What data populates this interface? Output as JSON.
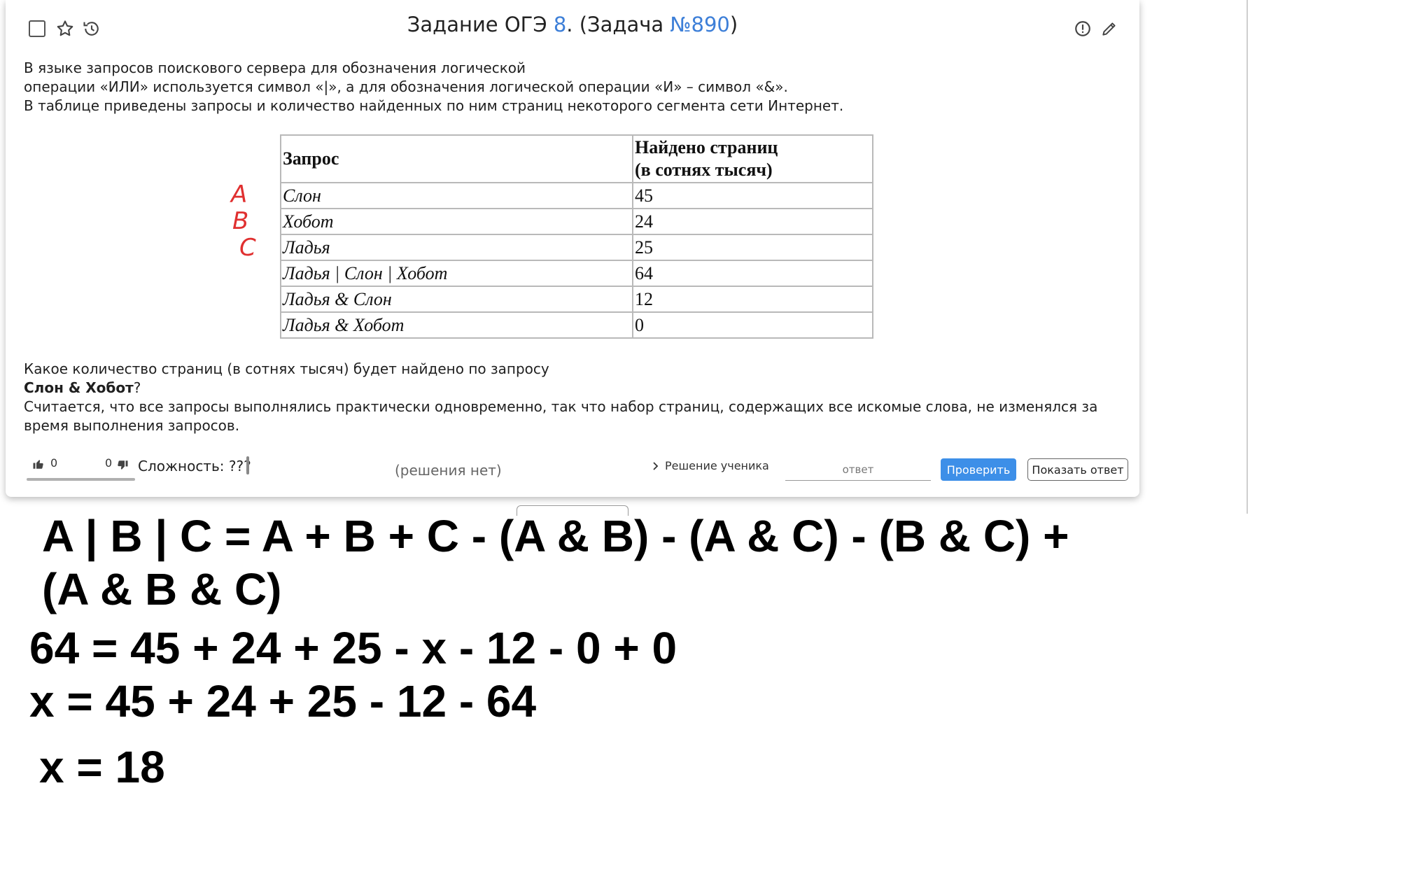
{
  "header": {
    "title_prefix": "Задание ОГЭ ",
    "task_number": "8",
    "title_middle": ". (Задача ",
    "problem_id": "№890",
    "title_suffix": ")"
  },
  "problem": {
    "lines": [
      "В языке запросов поискового сервера для обозначения логической",
      "операции «ИЛИ» используется символ «|», а для обозначения логической операции «И» – символ «&».",
      "В таблице приведены запросы и количество найденных по ним страниц некоторого сегмента сети Интернет."
    ],
    "table": {
      "headers": [
        "Запрос",
        "Найдено страниц\n(в сотнях тысяч)"
      ],
      "rows": [
        [
          "Слон",
          "45"
        ],
        [
          "Хобот",
          "24"
        ],
        [
          "Ладья",
          "25"
        ],
        [
          "Ладья | Слон | Хобот",
          "64"
        ],
        [
          "Ладья & Слон",
          "12"
        ],
        [
          "Ладья & Хобот",
          "0"
        ]
      ]
    },
    "annotations": [
      "A",
      "B",
      "C"
    ],
    "question": "Какое количество страниц (в сотнях тысяч) будет найдено по запросу",
    "query_bold": "Слон & Хобот",
    "query_suffix": "?",
    "note": "Считается, что все запросы выполнялись практически одновременно, так что набор страниц, содержащих все искомые слова, не изменялся за время выполнения запросов."
  },
  "footer": {
    "likes": "0",
    "dislikes": "0",
    "difficulty_label": "Сложность: ???",
    "solutions": "(решения нет)",
    "student_solution": "Решение ученика",
    "answer_placeholder": "ответ",
    "check_label": "Проверить",
    "show_label": "Показать ответ"
  },
  "solution": {
    "formula_line1": "A | B | C = A + B + C - (A & B) - (A & C) - (B & C) +",
    "formula_line2": "(A & B & C)",
    "line3": "64 = 45 + 24 + 25 - x - 12 - 0 + 0",
    "line4": "x = 45 + 24 + 25 - 12 - 64",
    "line5": "x = 18"
  }
}
